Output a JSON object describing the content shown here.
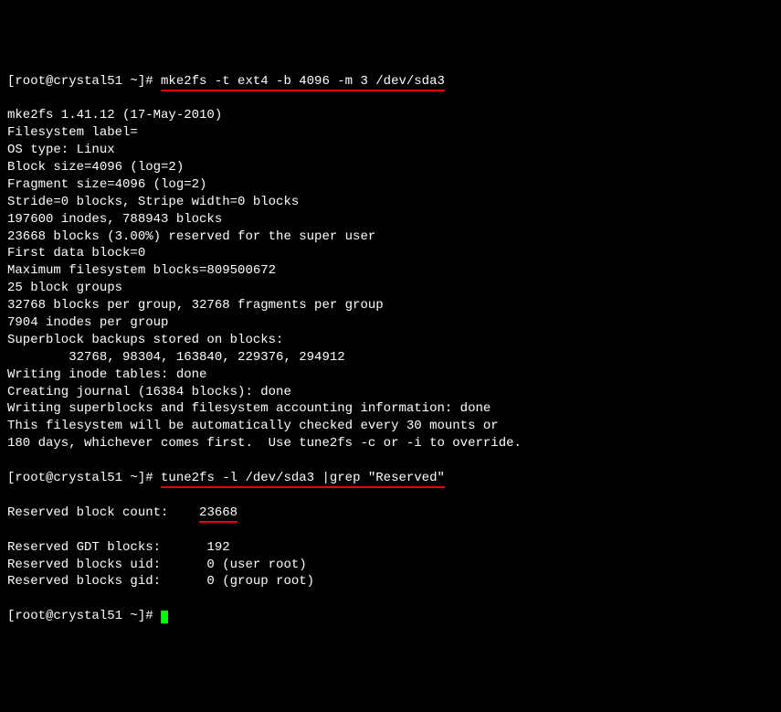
{
  "prompt1_open": "[root@crystal51 ~]# ",
  "cmd1": "mke2fs -t ext4 -b 4096 -m 3 /dev/sda3",
  "output1": [
    "mke2fs 1.41.12 (17-May-2010)",
    "Filesystem label=",
    "OS type: Linux",
    "Block size=4096 (log=2)",
    "Fragment size=4096 (log=2)",
    "Stride=0 blocks, Stripe width=0 blocks",
    "197600 inodes, 788943 blocks",
    "23668 blocks (3.00%) reserved for the super user",
    "First data block=0",
    "Maximum filesystem blocks=809500672",
    "25 block groups",
    "32768 blocks per group, 32768 fragments per group",
    "7904 inodes per group",
    "Superblock backups stored on blocks:",
    "        32768, 98304, 163840, 229376, 294912",
    "",
    "Writing inode tables: done",
    "Creating journal (16384 blocks): done",
    "Writing superblocks and filesystem accounting information: done",
    "",
    "This filesystem will be automatically checked every 30 mounts or",
    "180 days, whichever comes first.  Use tune2fs -c or -i to override."
  ],
  "prompt2_open": "[root@crystal51 ~]# ",
  "cmd2": "tune2fs -l /dev/sda3 |grep \"Reserved\"",
  "output2_line1_label": "Reserved block count:    ",
  "output2_line1_value": "23668",
  "output2_rest": [
    "Reserved GDT blocks:      192",
    "Reserved blocks uid:      0 (user root)",
    "Reserved blocks gid:      0 (group root)"
  ],
  "prompt3_open": "[root@crystal51 ~]# "
}
